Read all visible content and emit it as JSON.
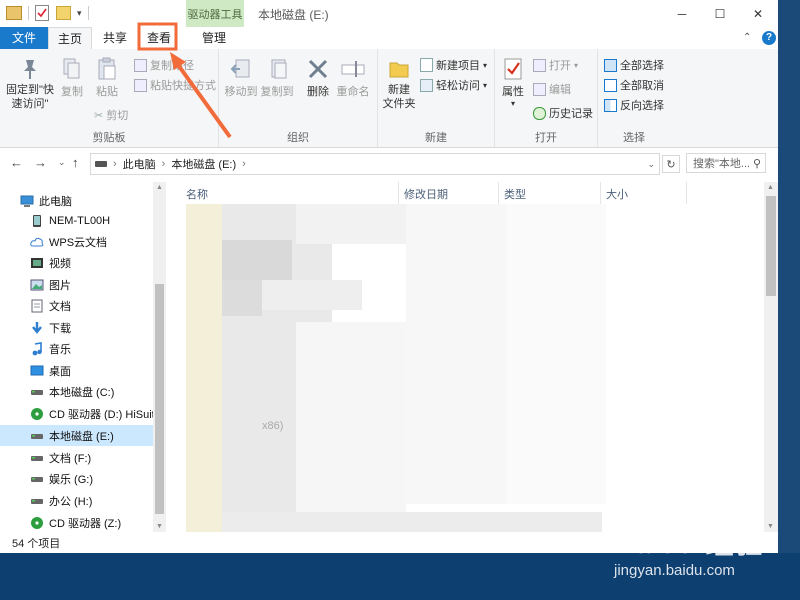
{
  "window": {
    "title": "本地磁盘 (E:)",
    "context_tab": "驱动器工具"
  },
  "tabs": {
    "file": "文件",
    "home": "主页",
    "share": "共享",
    "view": "查看",
    "manage": "管理"
  },
  "ribbon": {
    "clipboard": {
      "label": "剪贴板",
      "pin": "固定到\"快\n速访问\"",
      "copy": "复制",
      "paste": "粘贴",
      "copy_path": "复制路径",
      "paste_shortcut": "粘贴快捷方式",
      "cut": "剪切"
    },
    "organize": {
      "label": "组织",
      "move_to": "移动到",
      "copy_to": "复制到",
      "delete": "删除",
      "rename": "重命名"
    },
    "new": {
      "label": "新建",
      "new_folder": "新建\n文件夹",
      "new_item": "新建项目",
      "easy_access": "轻松访问"
    },
    "open": {
      "label": "打开",
      "properties": "属性",
      "open": "打开",
      "edit": "编辑",
      "history": "历史记录"
    },
    "select": {
      "label": "选择",
      "select_all": "全部选择",
      "select_none": "全部取消",
      "invert": "反向选择"
    }
  },
  "address": {
    "root": "此电脑",
    "drive": "本地磁盘 (E:)",
    "search_placeholder": "搜索\"本地..."
  },
  "columns": {
    "name": "名称",
    "date": "修改日期",
    "type": "类型",
    "size": "大小"
  },
  "nav": [
    {
      "label": "此电脑",
      "icon": "computer-icon"
    },
    {
      "label": "NEM-TL00H",
      "icon": "phone-icon"
    },
    {
      "label": "WPS云文档",
      "icon": "cloud-icon"
    },
    {
      "label": "视频",
      "icon": "video-icon"
    },
    {
      "label": "图片",
      "icon": "picture-icon"
    },
    {
      "label": "文档",
      "icon": "document-icon"
    },
    {
      "label": "下载",
      "icon": "download-icon"
    },
    {
      "label": "音乐",
      "icon": "music-icon"
    },
    {
      "label": "桌面",
      "icon": "desktop-icon"
    },
    {
      "label": "本地磁盘 (C:)",
      "icon": "drive-icon"
    },
    {
      "label": "CD 驱动器 (D:) HiSuite",
      "icon": "cd-icon"
    },
    {
      "label": "本地磁盘 (E:)",
      "icon": "drive-icon"
    },
    {
      "label": "文档 (F:)",
      "icon": "drive-icon"
    },
    {
      "label": "娱乐 (G:)",
      "icon": "drive-icon"
    },
    {
      "label": "办公 (H:)",
      "icon": "drive-icon"
    },
    {
      "label": "CD 驱动器 (Z:)",
      "icon": "cd-icon"
    }
  ],
  "status": {
    "count": "54 个项目"
  },
  "blurred_text": {
    "x86": "x86)"
  },
  "watermark": {
    "brand": "Baidu 经验",
    "url": "jingyan.baidu.com"
  },
  "colors": {
    "accent": "#1979ca",
    "highlight": "#f26b3a",
    "context_tab": "#cfe9c4",
    "selected": "#cce8ff"
  }
}
